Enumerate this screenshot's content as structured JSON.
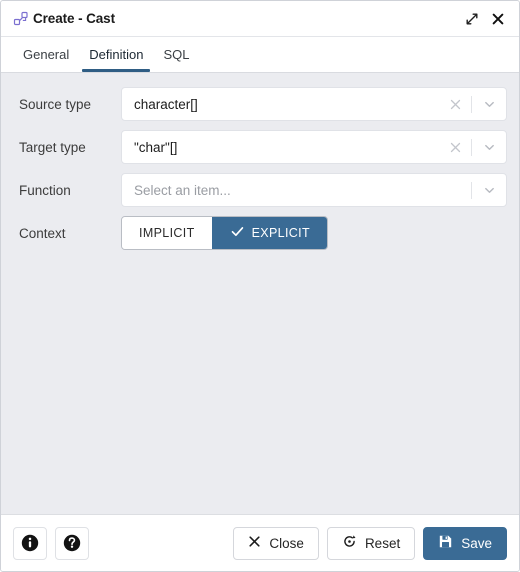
{
  "window": {
    "title": "Create - Cast",
    "title_icon": "cast-nodes-icon",
    "expand_icon": "expand-icon",
    "close_icon": "close-icon"
  },
  "tabs": [
    {
      "label": "General",
      "active": false
    },
    {
      "label": "Definition",
      "active": true
    },
    {
      "label": "SQL",
      "active": false
    }
  ],
  "form": {
    "source_type": {
      "label": "Source type",
      "value": "character[]",
      "placeholder": "Select an item...",
      "has_clear": true
    },
    "target_type": {
      "label": "Target type",
      "value": "\"char\"[]",
      "placeholder": "Select an item...",
      "has_clear": true
    },
    "function": {
      "label": "Function",
      "value": "",
      "placeholder": "Select an item...",
      "has_clear": false
    },
    "context": {
      "label": "Context",
      "options": [
        {
          "label": "IMPLICIT",
          "selected": false
        },
        {
          "label": "EXPLICIT",
          "selected": true
        }
      ]
    }
  },
  "footer": {
    "info_icon": "info-icon",
    "help_icon": "help-icon",
    "close_label": "Close",
    "reset_label": "Reset",
    "save_label": "Save"
  },
  "colors": {
    "accent": "#3a6b95",
    "tab_underline": "#2f5d84",
    "body_bg": "#ebecf0",
    "title_icon": "#7b6fd0"
  }
}
